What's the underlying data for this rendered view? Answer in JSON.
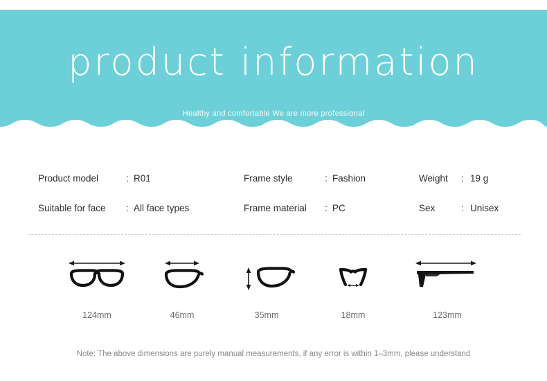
{
  "header": {
    "title": "product information",
    "subtitle": "Healthy and comfortable We are more professional",
    "background_color": "#6dd0d8",
    "text_color": "#ffffff",
    "wave_icon": "wave-scallop-divider"
  },
  "specs": {
    "rows": [
      {
        "cells": [
          {
            "label": "Product model",
            "colon": ":",
            "value": "R01"
          },
          {
            "label": "Frame style",
            "colon": ":",
            "value": "Fashion"
          },
          {
            "label": "Weight",
            "colon": ":",
            "value": "19 g"
          }
        ]
      },
      {
        "cells": [
          {
            "label": "Suitable for face",
            "colon": ":",
            "value": "All face types"
          },
          {
            "label": "Frame material",
            "colon": ":",
            "value": "PC"
          },
          {
            "label": "Sex",
            "colon": ":",
            "value": "Unisex"
          }
        ]
      }
    ]
  },
  "dimensions": {
    "items": [
      {
        "label": "124mm",
        "icon": "glasses-front-width-icon",
        "measure": "total frame width"
      },
      {
        "label": "46mm",
        "icon": "lens-width-icon",
        "measure": "lens width"
      },
      {
        "label": "35mm",
        "icon": "lens-height-icon",
        "measure": "lens height"
      },
      {
        "label": "18mm",
        "icon": "bridge-width-icon",
        "measure": "bridge width"
      },
      {
        "label": "123mm",
        "icon": "temple-length-icon",
        "measure": "temple length"
      }
    ]
  },
  "footnote": {
    "text": "Note: The above dimensions are purely manual measurements, if any error is within 1–3mm, please understand"
  }
}
